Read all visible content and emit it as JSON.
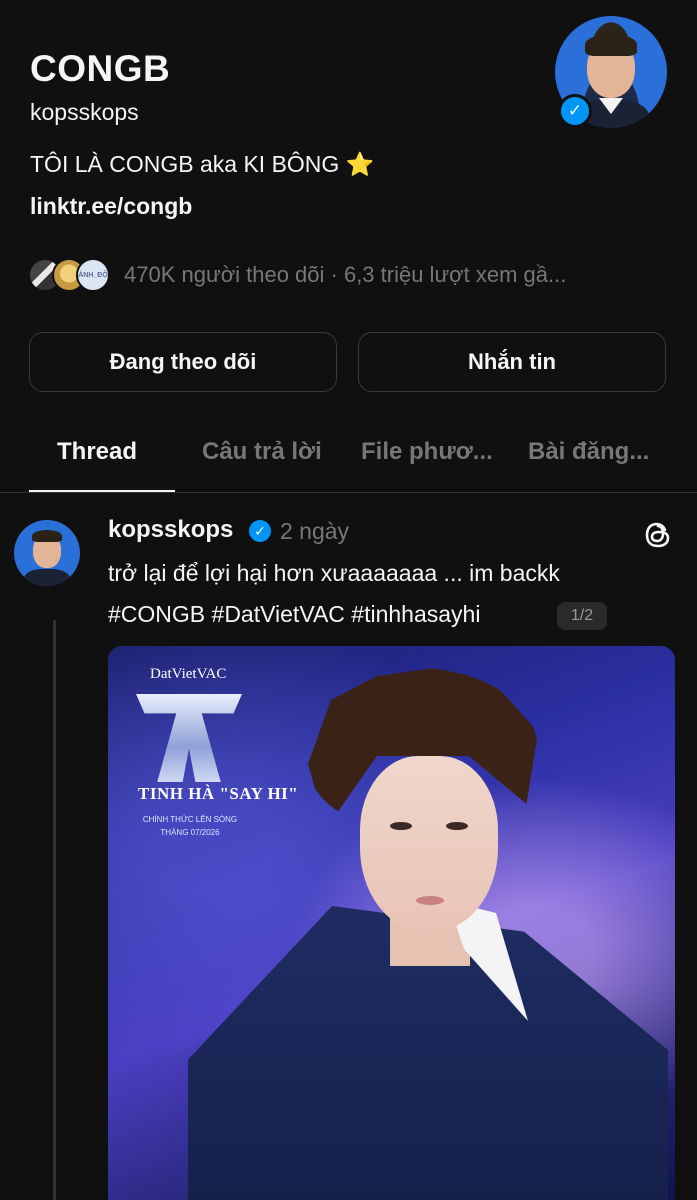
{
  "profile": {
    "name": "CONGB",
    "handle": "kopsskops",
    "bio": "TÔI LÀ CONGB aka KI BÔNG ⭐",
    "link": "linktr.ee/congb",
    "stats": "470K người theo dõi · 6,3 triệu lượt xem gầ...",
    "mini_avatar_text": "ẢNH_ĐỘ",
    "verified_icon": "✓"
  },
  "buttons": {
    "follow": "Đang theo dõi",
    "message": "Nhắn tin"
  },
  "tabs": [
    "Thread",
    "Câu trả lời",
    "File phươ...",
    "Bài đăng..."
  ],
  "post": {
    "username": "kopsskops",
    "time": "2 ngày",
    "text_line1": "trở lại để lợi hại hơn xưaaaaaaa ... im backk",
    "text_line2": "#CONGB #DatVietVAC #tinhhasayhi",
    "counter": "1/2",
    "media": {
      "brand": "DatVietVAC",
      "show_title": "TINH HÀ \"SAY HI\"",
      "show_sub_line1": "CHÍNH THỨC LÊN SÓNG",
      "show_sub_line2": "THÁNG 07/2026"
    }
  },
  "colors": {
    "background": "#101010",
    "text": "#f3f5f7",
    "muted": "#777777",
    "verified": "#0095f6",
    "border": "#3a3a3a"
  }
}
